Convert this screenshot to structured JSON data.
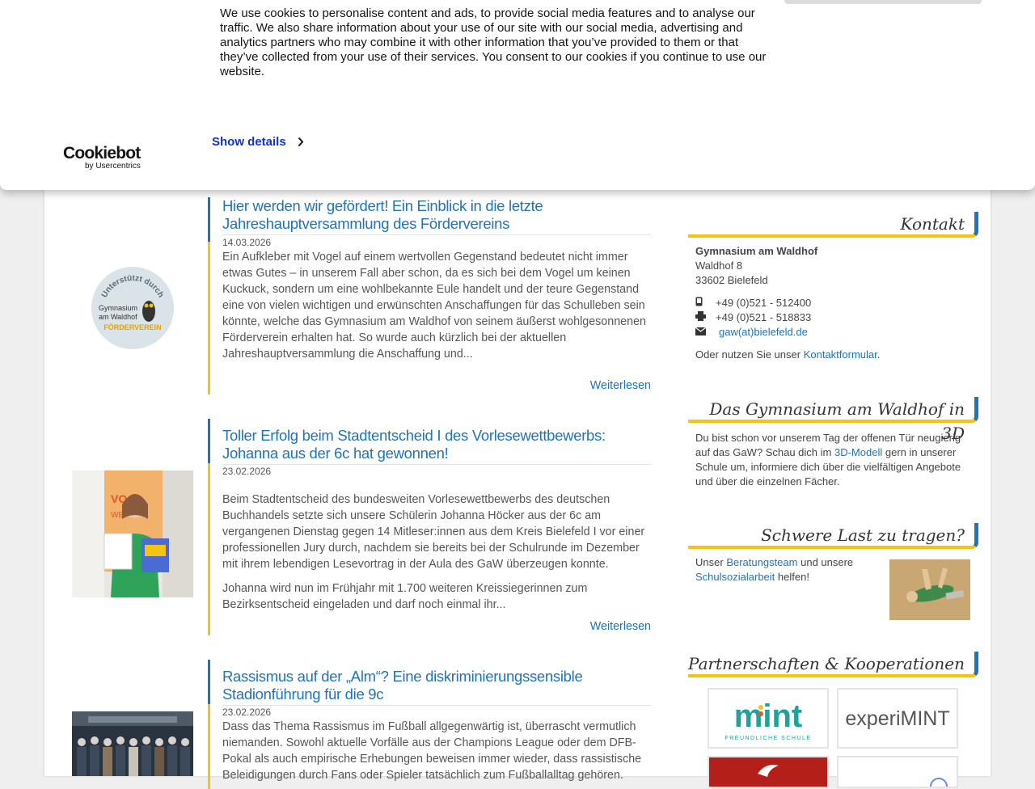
{
  "cookie": {
    "text": "We use cookies to personalise content and ads, to provide social media features and to analyse our traffic. We also share information about your use of our site with our social media, advertising and analytics partners who may combine it with other information that you’ve provided to them or that they’ve collected from your use of their services. You consent to our cookies if you continue to use our website.",
    "show_details": "Show details",
    "logo_word": "Cookiebot",
    "logo_sub": "by Usercentrics"
  },
  "articles": [
    {
      "title": "Hier werden wir gefördert! Ein Einblick in die letzte Jahreshauptversammlung des Fördervereins",
      "date": "14.03.2026",
      "paragraphs": [
        "Ein Aufkleber mit Vogel auf einem wertvollen Gegenstand bedeutet nicht immer etwas Gutes – in unserem Fall aber schon, da es sich bei dem Vogel um keinen Kuckuck, sondern um eine wohlbekannte Eule handelt und der teure Gegenstand eine von vielen wichtigen und erwünschten Anschaffungen für das Schulleben sein könnte, welche das Gymnasium am Waldhof von seinem äußerst wohlgesonnenen Förderverein erhalten hat. So wurde auch kürzlich bei der aktuellen Jahreshauptversammlung die Anschaffung und..."
      ],
      "readmore": "Weiterlesen",
      "badge": {
        "arc_text": "Unterstützt durch",
        "line1": "Gymnasium",
        "line2": "am Waldhof",
        "line3": "FÖRDERVEREIN"
      }
    },
    {
      "title": "Toller Erfolg beim Stadtentscheid I des Vorlesewettbewerbs: Johanna aus der 6c hat gewonnen!",
      "date": "23.02.2026",
      "paragraphs": [
        "Beim Stadtentscheid des bundesweiten Vorlesewettbewerbs des deutschen Buchhandels setzte sich unsere Schülerin Johanna Höcker aus der 6c am vergangenen Dienstag gegen 14 Mitleser:innen aus dem Kreis Bielefeld I vor einer professionellen Jury durch, nachdem sie bereits bei der Schulrunde im Dezember mit ihrem lebendigen Lesevortrag in der Aula des GaW überzeugen konnte.",
        "Johanna wird nun im Frühjahr mit 1.700 weiteren Kreissiegerinnen zum Bezirksentscheid eingeladen und darf noch einmal ihr..."
      ],
      "readmore": "Weiterlesen"
    },
    {
      "title": "Rassismus auf der „Alm“? Eine diskriminierungssensible Stadionführung für die 9c",
      "date": "23.02.2026",
      "paragraphs": [
        "Dass das Thema Rassismus im Fußball allgegenwärtig ist, überrascht vermutlich niemanden. Sowohl aktuelle Vorfälle aus der Champions League oder dem DFB-Pokal als auch empirische Erhebungen beweisen immer wieder, dass rassistische Beleidigungen durch Fans oder Spieler tatsächlich zum Fußballalltag gehören."
      ]
    }
  ],
  "sidebar": {
    "kontakt": {
      "heading": "Kontakt",
      "name": "Gymnasium am Waldhof",
      "street": "Waldhof 8",
      "city": "33602 Bielefeld",
      "phone": "+49 (0)521 - 512400",
      "fax": "+49 (0)521 - 518833",
      "email": "gaw(at)bielefeld.de",
      "form_prefix": "Oder nutzen Sie unser",
      "form_link": "Kontaktformular",
      "form_suffix": "."
    },
    "gaw3d": {
      "heading": "Das Gymnasium am Waldhof in 3D",
      "pre": "Du bist schon vor unserem Tag der offenen Tür neugierig auf das GaW? Schau dich im",
      "link": "3D-Modell",
      "post": "gern in unserer Schule um, informiere dich über die vielfältigen Angebote und über die einzelnen Fächer."
    },
    "last": {
      "heading": "Schwere Last zu tragen?",
      "pre": "Unser",
      "link1": "Beratungsteam",
      "mid": "und unsere",
      "link2": "Schulsozialarbeit",
      "post": "helfen!"
    },
    "partner": {
      "heading": "Partnerschaften & Kooperationen",
      "mint_word": "mint",
      "mint_sub": "FREUNDLICHE SCHULE",
      "experimint": "experiMINT"
    }
  },
  "colors": {
    "link_blue": "#1f73b7",
    "accent_yellow": "#f6c312",
    "cookiebot_blue": "#1032cf"
  }
}
